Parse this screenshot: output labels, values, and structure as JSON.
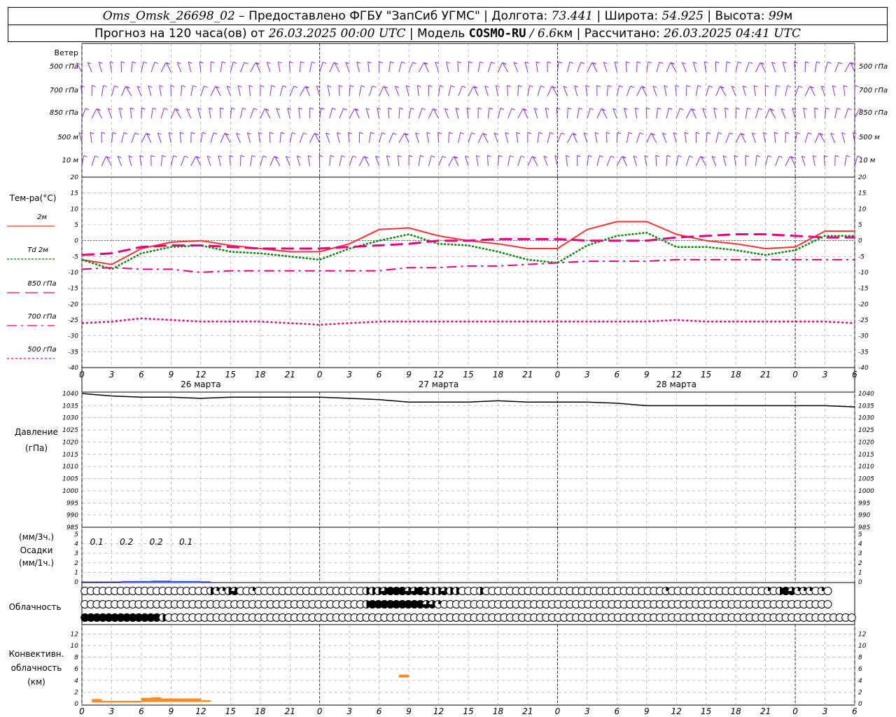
{
  "header": {
    "station": "Oms_Omsk_26698_02",
    "provided_by": " – Предоставлено ФГБУ \"ЗапСиб УГМС\" | Долгота: ",
    "longitude": "73.441",
    "lat_label": " | Широта: ",
    "latitude": "54.925",
    "alt_label": " | Высота: ",
    "altitude": "99",
    "alt_unit": "м",
    "forecast_label": "Прогноз на 120 часа(ов) от ",
    "forecast_start": "26.03.2025 00:00 UTC",
    "model_label": "  | Модель ",
    "model": "COSMO-RU",
    "resolution": " / 6.6",
    "res_unit": "км",
    "calc_label": " | Рассчитано: ",
    "calc_time": "26.03.2025 04:41 UTC"
  },
  "colors": {
    "wind": "#8a2be2",
    "t2m": "#ff3030",
    "td2m": "#008800",
    "t850": "#e6007e",
    "t700": "#e6007e",
    "t500": "#e6007e",
    "pressure": "#000000",
    "precip": "#1e3cff",
    "convective": "#ff8a20",
    "grid": "#999999",
    "zero_line": "#3050ff"
  },
  "chart_data": [
    {
      "type": "wind_barbs",
      "title": "Ветер",
      "levels": [
        "500 гПа",
        "700 гПа",
        "850 гПа",
        "500 м",
        "10 м"
      ]
    },
    {
      "type": "line",
      "ylabel": "Тем-ра(°С)",
      "ylim": [
        -40,
        20
      ],
      "ytick_step": 5,
      "x_hours": [
        0,
        3,
        6,
        9,
        12,
        15,
        18,
        21,
        24,
        27,
        30,
        33,
        36,
        39,
        42,
        45,
        48,
        51,
        54,
        57,
        60,
        63,
        66,
        69,
        72,
        75,
        78
      ],
      "x_tick_labels": [
        "0",
        "3",
        "6",
        "9",
        "12",
        "15",
        "18",
        "21",
        "0",
        "3",
        "6",
        "9",
        "12",
        "15",
        "18",
        "21",
        "0",
        "3",
        "6",
        "9",
        "12",
        "15",
        "18",
        "21",
        "0",
        "3",
        "6"
      ],
      "date_labels": [
        "26 марта",
        "27 марта",
        "28 марта"
      ],
      "legend": [
        "2м",
        "Td 2м",
        "850 гПа",
        "700 гПа",
        "500 гПа"
      ],
      "series": [
        {
          "name": "2м",
          "values": [
            -6,
            -7.5,
            -2.5,
            -0.5,
            0,
            -1.5,
            -2.5,
            -3.5,
            -3.5,
            -1,
            3.5,
            4,
            1.5,
            0,
            -1,
            -2.5,
            -2.5,
            3.5,
            6,
            6,
            2,
            0,
            -1,
            -2.5,
            -2,
            3,
            3
          ]
        },
        {
          "name": "Td 2м",
          "values": [
            -6,
            -9,
            -4,
            -2,
            -1.5,
            -3.5,
            -4,
            -5,
            -6,
            -2.5,
            0,
            2,
            -1,
            -1.5,
            -3.5,
            -6,
            -7,
            -1.5,
            1.5,
            2.5,
            -2,
            -2,
            -3,
            -4.5,
            -3,
            1.5,
            1.5
          ]
        },
        {
          "name": "850 гПа",
          "values": [
            -4.5,
            -4,
            -2,
            -1.5,
            -1.5,
            -2,
            -2.5,
            -2.5,
            -2.5,
            -2,
            -1.5,
            -1,
            0,
            0,
            0.5,
            0.5,
            0.5,
            0,
            0,
            0,
            1,
            1.5,
            2,
            2,
            1.5,
            1,
            1
          ]
        },
        {
          "name": "700 гПа",
          "values": [
            -9,
            -8.5,
            -9,
            -9,
            -10,
            -9.5,
            -9.5,
            -9.5,
            -9.5,
            -9.5,
            -9.5,
            -8.5,
            -8.5,
            -8,
            -8,
            -7.5,
            -7,
            -6.5,
            -6.5,
            -6.5,
            -6,
            -6,
            -6,
            -6,
            -6,
            -6,
            -6
          ]
        },
        {
          "name": "500 гПа",
          "values": [
            -26,
            -25.5,
            -24.5,
            -25,
            -25.5,
            -25.5,
            -25.5,
            -26,
            -26.5,
            -26,
            -25.5,
            -25.5,
            -25.5,
            -25.5,
            -25.5,
            -25.5,
            -25.5,
            -25.5,
            -25.5,
            -25.5,
            -25,
            -25.5,
            -25.5,
            -25.5,
            -25.5,
            -25.5,
            -26
          ]
        }
      ]
    },
    {
      "type": "line",
      "ylabel": "Давление",
      "yunit": "(гПа)",
      "ylim": [
        985,
        1040
      ],
      "ytick_step": 5,
      "series": [
        {
          "name": "Давление",
          "values": [
            1040,
            1039,
            1038.5,
            1038.5,
            1038,
            1038.5,
            1038.5,
            1038.5,
            1038.5,
            1038,
            1037.5,
            1036.5,
            1036.5,
            1036.5,
            1037,
            1036.5,
            1036.5,
            1036.5,
            1036,
            1035,
            1035,
            1035,
            1035,
            1035,
            1035,
            1035,
            1034.5
          ]
        }
      ]
    },
    {
      "type": "bar",
      "ylabel": "Осадки",
      "yunit_top": "(мм/3ч.)",
      "yunit_bottom": "(мм/1ч.)",
      "ylim": [
        0,
        5
      ],
      "precip_3h_labels": [
        "0.1",
        "0.2",
        "0.2",
        "0.1"
      ],
      "hourly_x": [
        0,
        1,
        2,
        3,
        4,
        5,
        6,
        7,
        8,
        9,
        10,
        11,
        12
      ],
      "hourly_values": [
        0.03,
        0.03,
        0.03,
        0.03,
        0.08,
        0.08,
        0.08,
        0.12,
        0.12,
        0.08,
        0.08,
        0.08,
        0.05
      ]
    },
    {
      "type": "table",
      "ylabel": "Облачность",
      "legend_note": "cloud cover 0..4 per hour, rows: upper / middle / low",
      "upper": [
        0,
        0,
        0,
        0,
        0,
        0,
        0,
        0,
        0,
        0,
        0,
        0,
        0,
        0,
        0,
        0,
        0,
        0,
        0,
        0,
        0,
        2,
        1,
        1,
        2,
        3,
        0,
        0,
        1,
        0,
        0,
        0,
        0,
        0,
        0,
        0,
        0,
        0,
        0,
        0,
        0,
        0,
        0,
        0,
        0,
        0,
        0,
        2,
        2,
        2,
        3,
        4,
        4,
        4,
        3,
        3,
        4,
        3,
        2,
        2,
        3,
        2,
        2,
        0,
        0,
        0,
        2,
        0,
        0,
        0,
        0,
        0,
        0,
        0,
        0,
        0,
        0,
        0,
        0,
        0,
        0,
        0,
        0,
        0,
        0,
        0,
        0,
        0,
        0,
        0,
        0,
        0,
        0,
        0,
        0,
        0,
        0,
        1,
        0,
        0,
        0,
        0,
        0,
        0,
        0,
        0,
        0,
        0,
        0,
        0,
        0,
        0,
        0,
        0,
        1,
        0,
        2,
        4,
        3,
        1,
        1,
        1,
        0,
        1,
        0
      ],
      "middle": [
        0,
        0,
        0,
        0,
        0,
        0,
        0,
        0,
        0,
        0,
        0,
        0,
        0,
        0,
        0,
        0,
        0,
        0,
        0,
        0,
        0,
        0,
        0,
        0,
        0,
        0,
        0,
        0,
        0,
        0,
        0,
        0,
        0,
        0,
        0,
        0,
        0,
        0,
        0,
        0,
        0,
        0,
        0,
        0,
        0,
        0,
        0,
        2,
        4,
        4,
        4,
        4,
        4,
        4,
        4,
        4,
        4,
        3,
        3,
        1,
        0,
        0,
        0,
        0,
        0,
        0,
        0,
        0,
        0,
        0,
        0,
        0,
        0,
        0,
        0,
        0,
        0,
        0,
        0,
        0,
        0,
        0,
        0,
        0,
        0,
        0,
        0,
        0,
        0,
        0,
        0,
        0,
        0,
        0,
        0,
        0,
        0,
        0,
        0,
        0,
        0,
        0,
        0,
        0,
        0,
        0,
        0,
        0,
        0,
        0,
        0,
        0,
        0,
        0,
        0,
        0,
        0,
        0,
        0,
        0,
        0,
        0,
        0,
        0,
        0
      ],
      "low": [
        4,
        4,
        4,
        4,
        4,
        4,
        4,
        4,
        4,
        4,
        4,
        4,
        4,
        2,
        0,
        0,
        0,
        0,
        0,
        0,
        0,
        0,
        0,
        0,
        0,
        0,
        0,
        0,
        0,
        0,
        0,
        0,
        0,
        0,
        0,
        0,
        0,
        0,
        0,
        0,
        0,
        0,
        0,
        0,
        0,
        0,
        0,
        0,
        0,
        0,
        0,
        0,
        0,
        0,
        0,
        0,
        0,
        0,
        0,
        0,
        0,
        0,
        0,
        0,
        0,
        0,
        0,
        0,
        0,
        0,
        0,
        0,
        0,
        0,
        0,
        0,
        0,
        0,
        0,
        0,
        0,
        0,
        0,
        0,
        0,
        0,
        0,
        0,
        0,
        0,
        0,
        0,
        0,
        0,
        0,
        0,
        0,
        0,
        0,
        0,
        0,
        0,
        0,
        0,
        0,
        0,
        0,
        0,
        0,
        0,
        0,
        0,
        0,
        0,
        0,
        0,
        0,
        0,
        0,
        0,
        0,
        0,
        0,
        0,
        0,
        0,
        0,
        0,
        0
      ]
    },
    {
      "type": "bar",
      "ylabel": "Конвективн. облачность",
      "yunit": "(км)",
      "ylim": [
        0,
        13
      ],
      "yticks": [
        0,
        2,
        4,
        6,
        8,
        10,
        12
      ],
      "segments": [
        {
          "x0": 1,
          "x1": 2,
          "base": 0.2,
          "top": 0.8
        },
        {
          "x0": 2,
          "x1": 6,
          "base": 0.2,
          "top": 0.5
        },
        {
          "x0": 6,
          "x1": 7,
          "base": 0.3,
          "top": 1.0
        },
        {
          "x0": 7,
          "x1": 8,
          "base": 0.3,
          "top": 1.1
        },
        {
          "x0": 8,
          "x1": 12,
          "base": 0.3,
          "top": 0.9
        },
        {
          "x0": 12,
          "x1": 13,
          "base": 0.3,
          "top": 0.6
        },
        {
          "x0": 32,
          "x1": 33,
          "base": 4.5,
          "top": 5.0
        }
      ]
    }
  ]
}
